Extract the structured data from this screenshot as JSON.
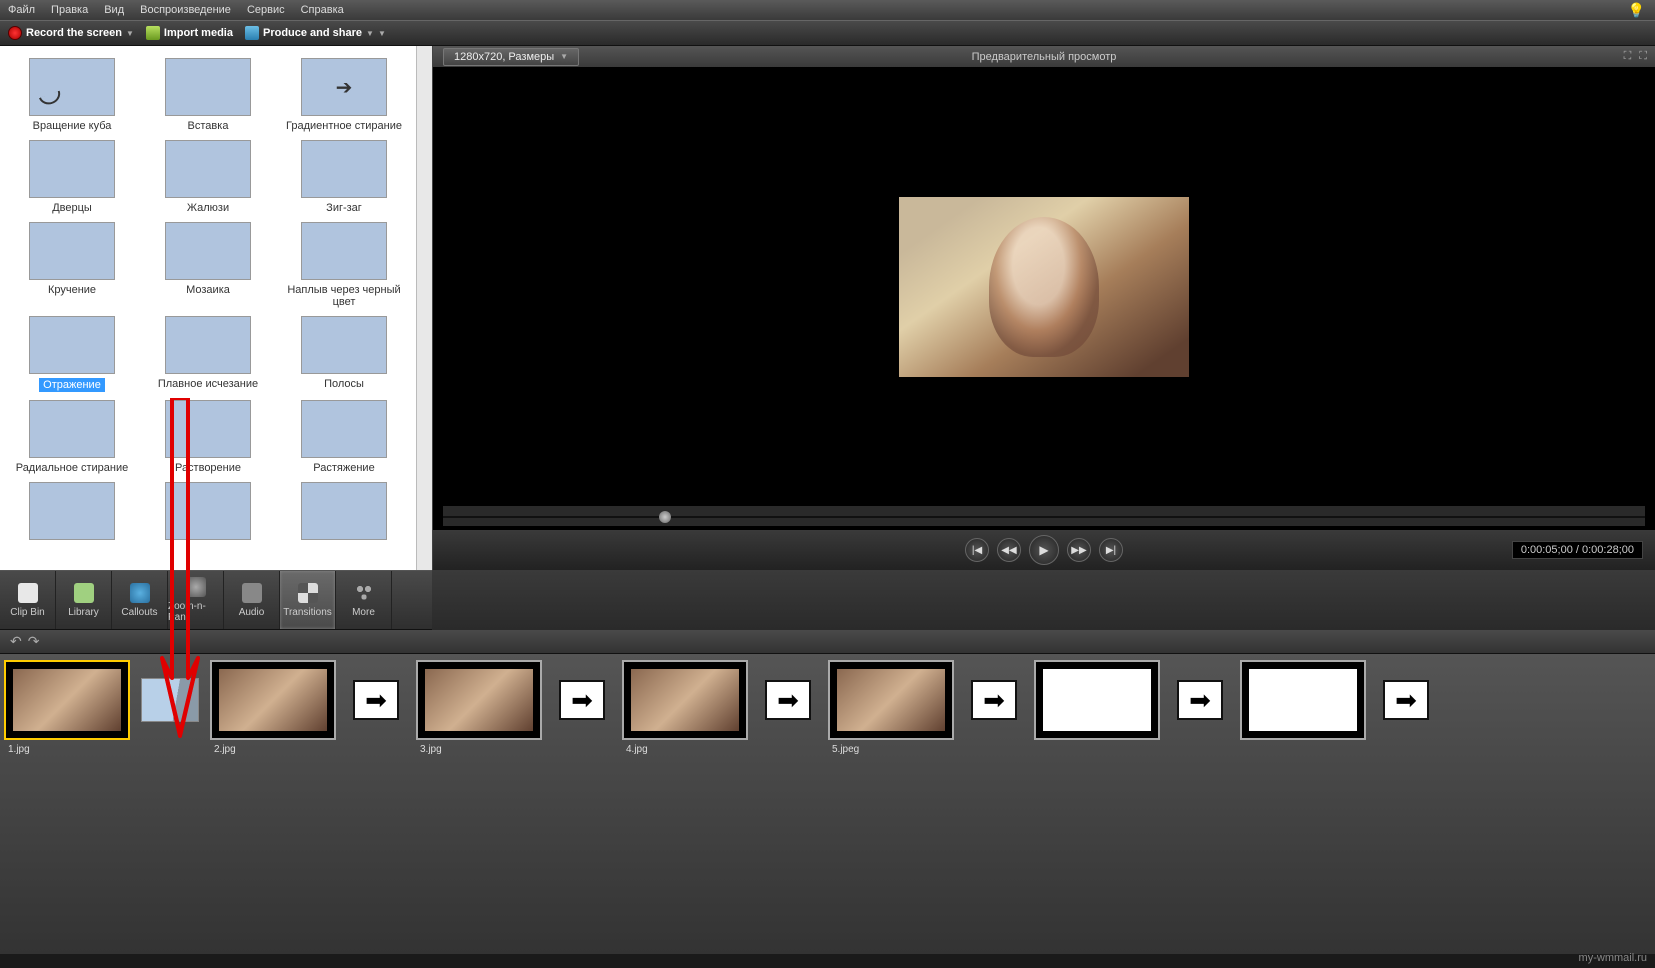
{
  "menu": [
    "Файл",
    "Правка",
    "Вид",
    "Воспроизведение",
    "Сервис",
    "Справка"
  ],
  "toolbar": {
    "record": "Record the screen",
    "import": "Import media",
    "produce": "Produce and share"
  },
  "preview": {
    "dimensions": "1280x720, Размеры",
    "title": "Предварительный просмотр",
    "timecode": "0:00:05;00 / 0:00:28;00"
  },
  "transitions": [
    [
      {
        "label": "Вращение куба",
        "th": "th-cube"
      },
      {
        "label": "Вставка",
        "th": "th-ins"
      },
      {
        "label": "Градиентное стирание",
        "th": "th-grad"
      }
    ],
    [
      {
        "label": "Дверцы",
        "th": "th-doors"
      },
      {
        "label": "Жалюзи",
        "th": "th-blinds"
      },
      {
        "label": "Зиг-заг",
        "th": "th-zig"
      }
    ],
    [
      {
        "label": "Кручение",
        "th": "th-spin"
      },
      {
        "label": "Мозаика",
        "th": "th-mos"
      },
      {
        "label": "Наплыв через черный цвет",
        "th": "th-black"
      }
    ],
    [
      {
        "label": "Отражение",
        "th": "th-refl",
        "selected": true
      },
      {
        "label": "Плавное исчезание",
        "th": "th-fade"
      },
      {
        "label": "Полосы",
        "th": "th-bars"
      }
    ],
    [
      {
        "label": "Радиальное стирание",
        "th": "th-rad"
      },
      {
        "label": "Растворение",
        "th": "th-diss"
      },
      {
        "label": "Растяжение",
        "th": "th-stretch"
      }
    ],
    [
      {
        "label": "",
        "th": "th-doors"
      },
      {
        "label": "",
        "th": "th-zig"
      },
      {
        "label": "",
        "th": "th-stretch"
      }
    ]
  ],
  "tooltabs": [
    {
      "label": "Clip Bin",
      "icon": "ic-clip"
    },
    {
      "label": "Library",
      "icon": "ic-lib"
    },
    {
      "label": "Callouts",
      "icon": "ic-call"
    },
    {
      "label": "Zoom-n-Pan",
      "icon": "ic-zoom"
    },
    {
      "label": "Audio",
      "icon": "ic-aud"
    },
    {
      "label": "Transitions",
      "icon": "ic-trans",
      "active": true
    },
    {
      "label": "More",
      "icon": "ic-more"
    }
  ],
  "clips": [
    {
      "file": "1.jpg",
      "blank": false
    },
    {
      "file": "2.jpg",
      "blank": false
    },
    {
      "file": "3.jpg",
      "blank": false
    },
    {
      "file": "4.jpg",
      "blank": false
    },
    {
      "file": "5.jpeg",
      "blank": false
    },
    {
      "file": "",
      "blank": true
    },
    {
      "file": "",
      "blank": true
    }
  ],
  "watermark": "my-wmmail.ru"
}
